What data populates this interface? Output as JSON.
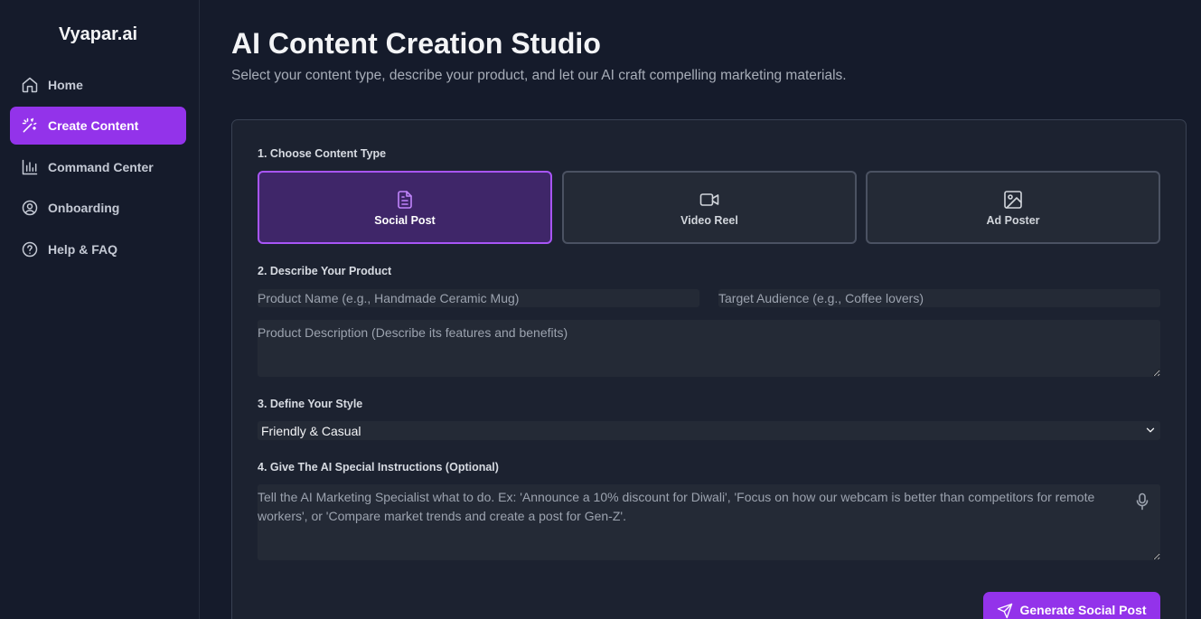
{
  "app": {
    "logo": "Vyapar.ai"
  },
  "sidebar": {
    "items": [
      {
        "label": "Home",
        "icon": "home-icon",
        "active": false
      },
      {
        "label": "Create Content",
        "icon": "sparkle-wand-icon",
        "active": true
      },
      {
        "label": "Command Center",
        "icon": "bar-chart-icon",
        "active": false
      },
      {
        "label": "Onboarding",
        "icon": "user-circle-icon",
        "active": false
      },
      {
        "label": "Help & FAQ",
        "icon": "help-circle-icon",
        "active": false
      }
    ]
  },
  "header": {
    "title": "AI Content Creation Studio",
    "subtitle": "Select your content type, describe your product, and let our AI craft compelling marketing materials."
  },
  "form": {
    "step1_label": "1. Choose Content Type",
    "content_types": [
      {
        "label": "Social Post",
        "icon": "document-icon",
        "selected": true
      },
      {
        "label": "Video Reel",
        "icon": "video-camera-icon",
        "selected": false
      },
      {
        "label": "Ad Poster",
        "icon": "image-icon",
        "selected": false
      }
    ],
    "step2_label": "2. Describe Your Product",
    "product_name": {
      "value": "",
      "placeholder": "Product Name (e.g., Handmade Ceramic Mug)"
    },
    "target_audience": {
      "value": "",
      "placeholder": "Target Audience (e.g., Coffee lovers)"
    },
    "product_description": {
      "value": "",
      "placeholder": "Product Description (Describe its features and benefits)"
    },
    "step3_label": "3. Define Your Style",
    "style_select": {
      "selected": "Friendly & Casual"
    },
    "step4_label": "4. Give The AI Special Instructions (Optional)",
    "instructions": {
      "value": "",
      "placeholder": "Tell the AI Marketing Specialist what to do. Ex: 'Announce a 10% discount for Diwali', 'Focus on how our webcam is better than competitors for remote workers', or 'Compare market trends and create a post for Gen-Z'."
    },
    "generate_label": "Generate Social Post"
  },
  "colors": {
    "background": "#151b2b",
    "card": "#1c2230",
    "accent": "#9333ea",
    "selected_tile": "#3f2669",
    "selected_border": "#a855f7"
  }
}
